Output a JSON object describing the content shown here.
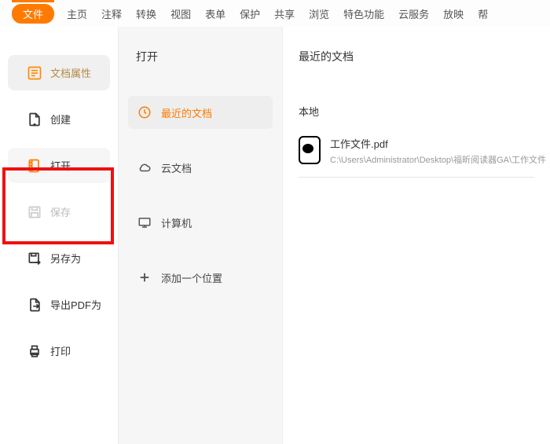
{
  "tabs": [
    "文件",
    "主页",
    "注释",
    "转换",
    "视图",
    "表单",
    "保护",
    "共享",
    "浏览",
    "特色功能",
    "云服务",
    "放映",
    "帮"
  ],
  "active_tab_index": 0,
  "sidebar": {
    "props": "文档属性",
    "create": "创建",
    "open": "打开",
    "save": "保存",
    "saveas": "另存为",
    "exportpdf": "导出PDF为",
    "print": "打印"
  },
  "mid": {
    "title": "打开",
    "recent": "最近的文档",
    "cloud": "云文档",
    "computer": "计算机",
    "addplace": "添加一个位置"
  },
  "right": {
    "title": "最近的文档",
    "section": "本地",
    "doc_title": "工作文件.pdf",
    "doc_path": "C:\\Users\\Administrator\\Desktop\\福昕阅读器GA\\工作文件"
  }
}
